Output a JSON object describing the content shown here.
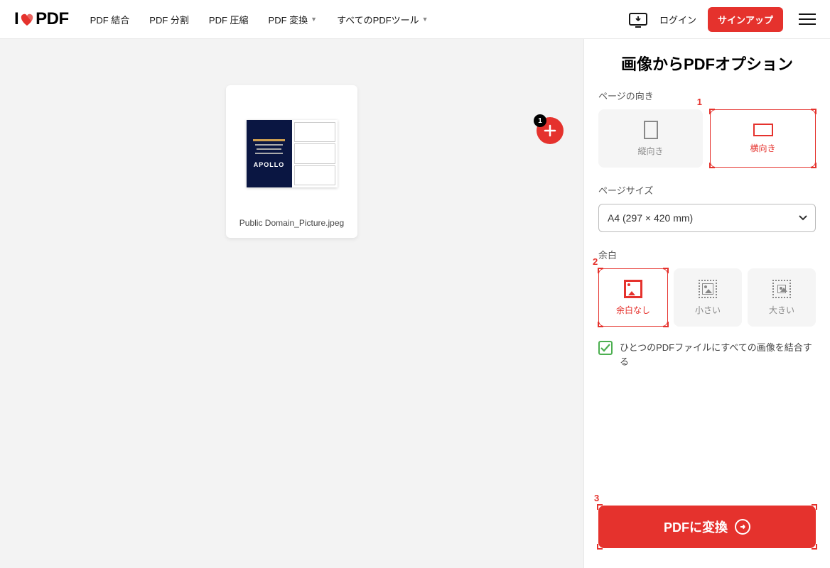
{
  "header": {
    "logo_prefix": "I",
    "logo_suffix": "PDF",
    "nav": {
      "merge": "PDF 結合",
      "split": "PDF 分割",
      "compress": "PDF 圧縮",
      "convert": "PDF 変換",
      "all_tools": "すべてのPDFツール"
    },
    "login": "ログイン",
    "signup": "サインアップ"
  },
  "canvas": {
    "file_name": "Public Domain_Picture.jpeg",
    "thumb_text": "APOLLO",
    "add_badge": "1"
  },
  "sidebar": {
    "title": "画像からPDFオプション",
    "orientation": {
      "label": "ページの向き",
      "portrait": "縦向き",
      "landscape": "横向き"
    },
    "page_size": {
      "label": "ページサイズ",
      "value": "A4 (297 × 420 mm)"
    },
    "margin": {
      "label": "余白",
      "none": "余白なし",
      "small": "小さい",
      "big": "大きい"
    },
    "merge_checkbox": "ひとつのPDFファイルにすべての画像を結合する",
    "convert_button": "PDFに変換"
  },
  "annotations": {
    "a1": "1",
    "a2": "2",
    "a3": "3"
  }
}
